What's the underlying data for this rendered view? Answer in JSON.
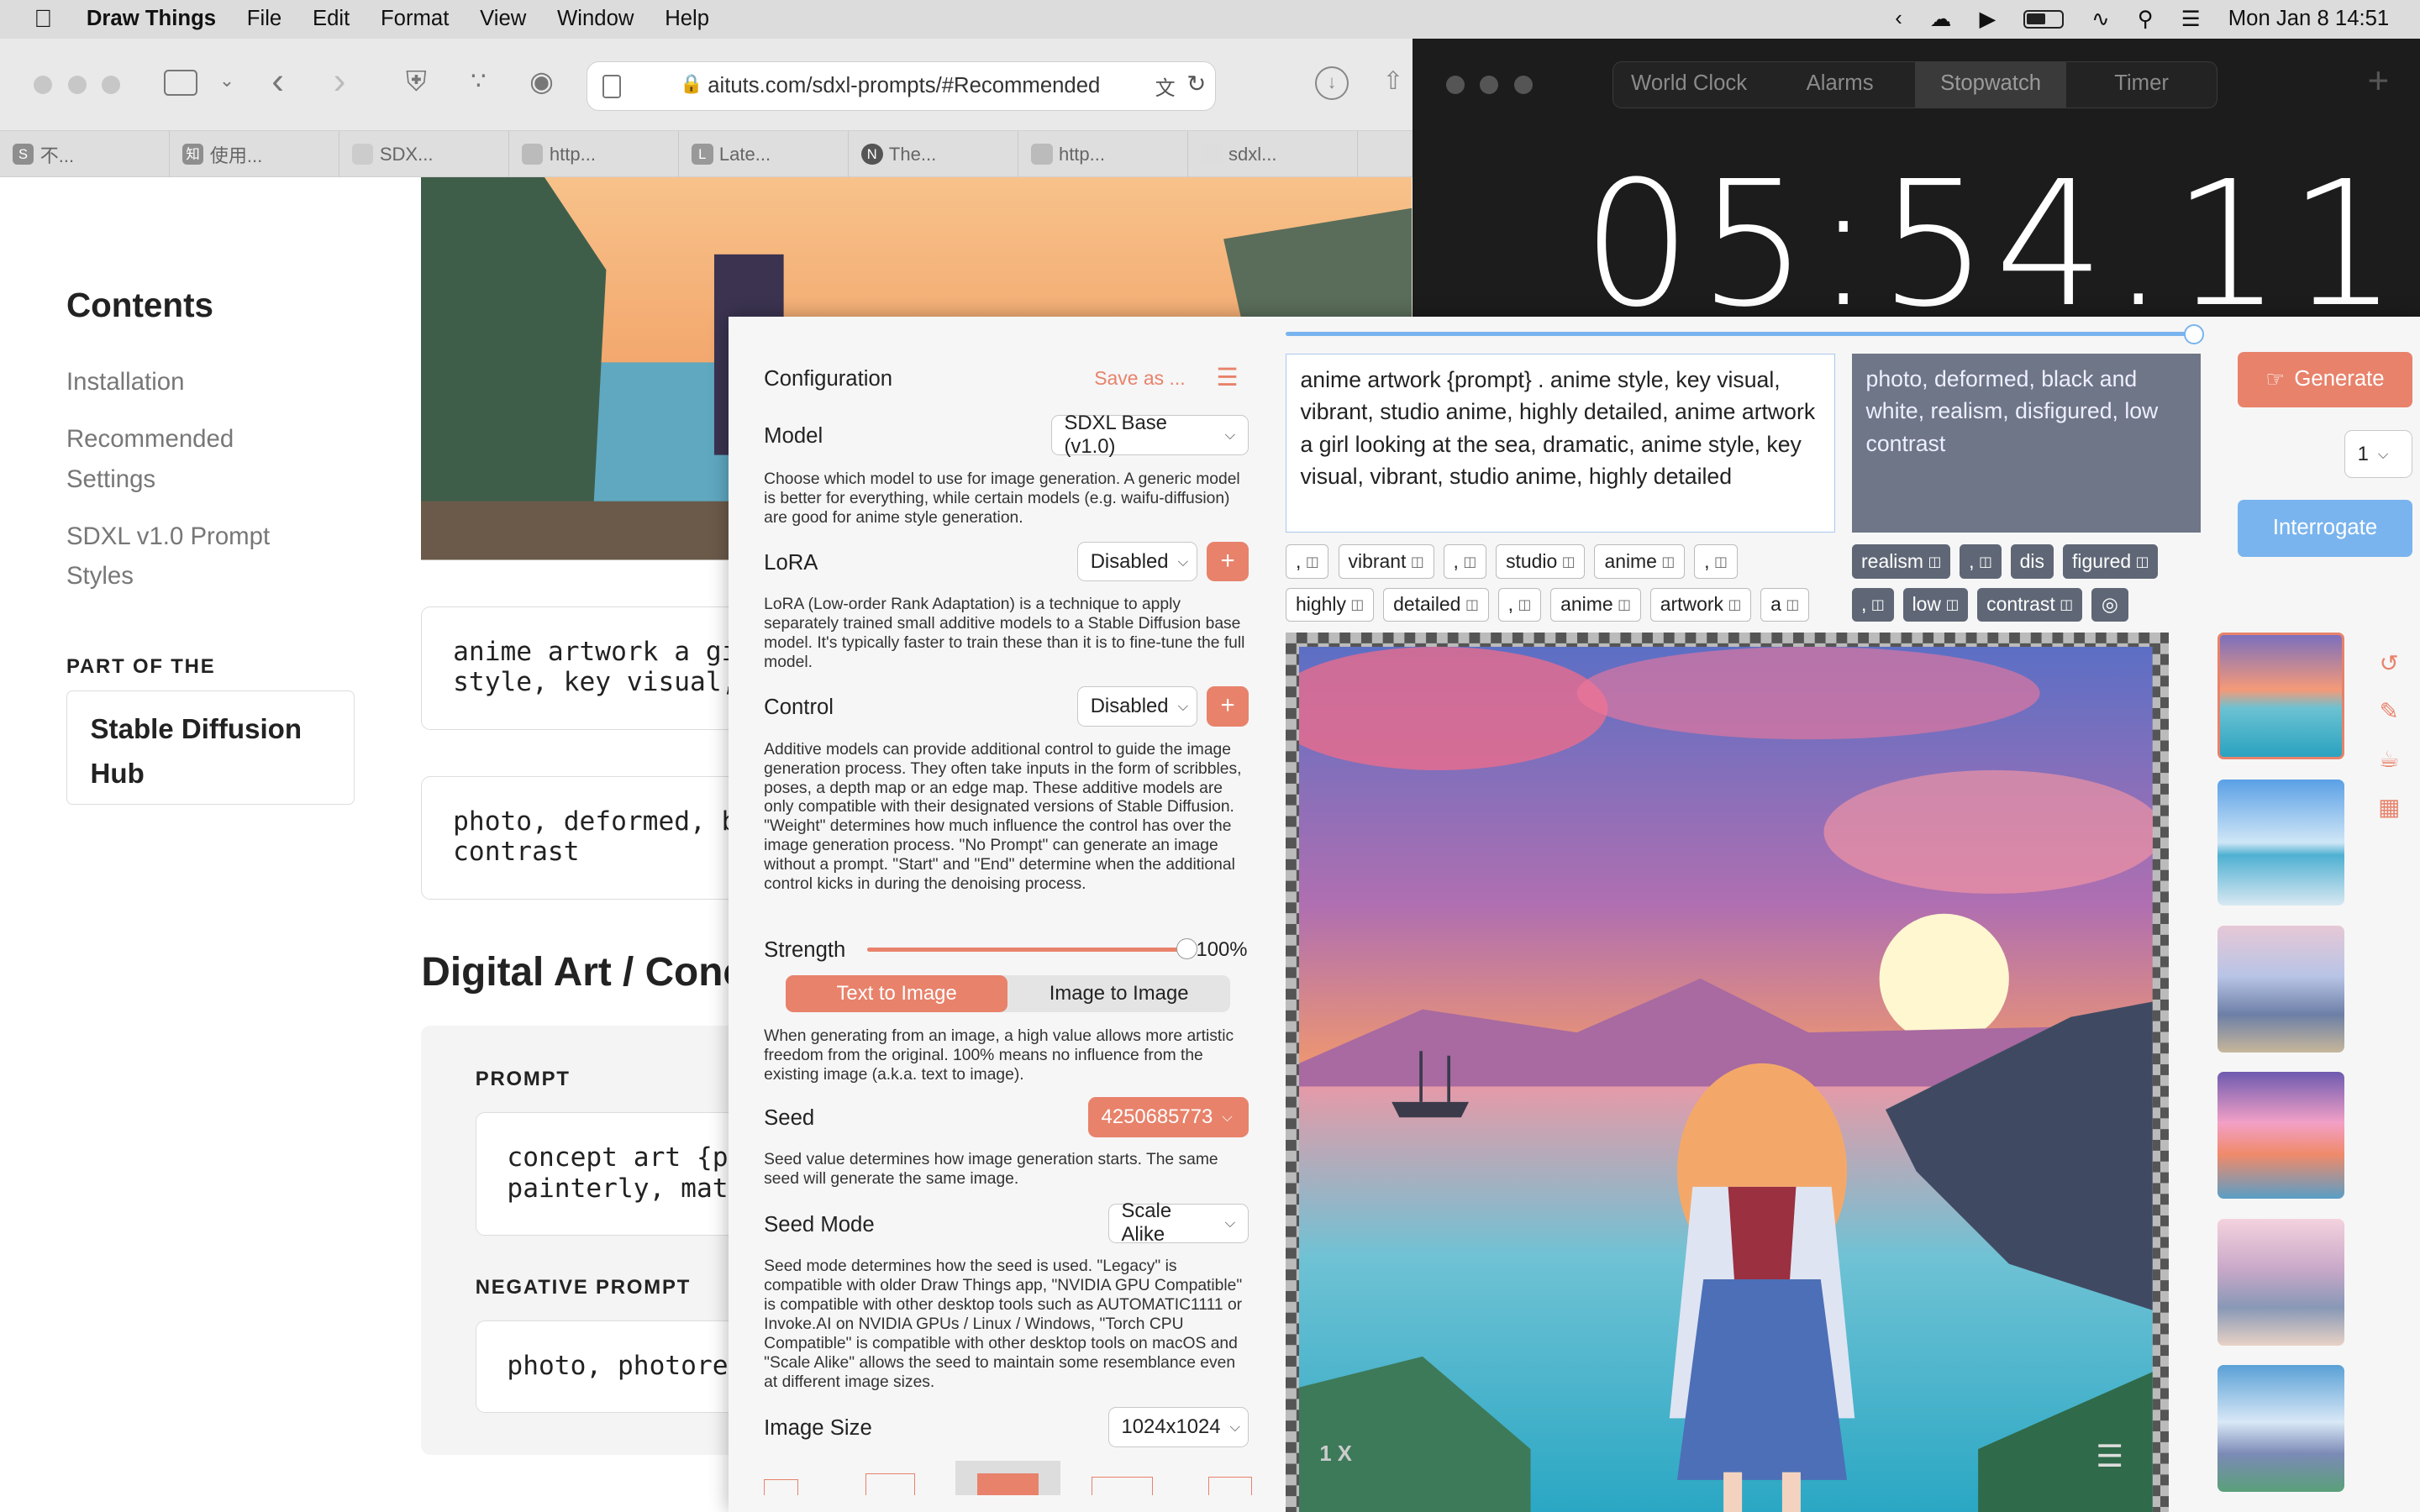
{
  "menubar": {
    "app": "Draw Things",
    "items": [
      "File",
      "Edit",
      "Format",
      "View",
      "Window",
      "Help"
    ],
    "datetime": "Mon Jan 8  14:51"
  },
  "browser": {
    "url": "aituts.com/sdxl-prompts/#Recommended",
    "tabs": [
      {
        "favicon": "S",
        "title": "不..."
      },
      {
        "favicon": "知",
        "title": "使用..."
      },
      {
        "favicon": "",
        "title": "SDX..."
      },
      {
        "favicon": "",
        "title": "http..."
      },
      {
        "favicon": "L",
        "title": "Late..."
      },
      {
        "favicon": "N",
        "title": "The..."
      },
      {
        "favicon": "",
        "title": "http..."
      },
      {
        "favicon": "",
        "title": "sdxl..."
      }
    ]
  },
  "page": {
    "contents_title": "Contents",
    "toc": [
      "Installation",
      "Recommended",
      "Settings",
      "SDXL v1.0 Prompt",
      "Styles"
    ],
    "part_of": "PART OF THE",
    "hub_line1": "Stable Diffusion",
    "hub_line2": "Hub",
    "code1_line1": "anime artwork a gi",
    "code1_line2": "style, key visual,",
    "code2_line1": "photo, deformed, b",
    "code2_line2": "contrast",
    "section_heading": "Digital Art / Conce",
    "prompt_label": "PROMPT",
    "code3_line1": "concept art {pr",
    "code3_line2": "painterly, matt",
    "neg_label": "NEGATIVE PROMPT",
    "code4_line1": "photo, photorea"
  },
  "clock": {
    "tabs": [
      "World Clock",
      "Alarms",
      "Stopwatch",
      "Timer"
    ],
    "selected_tab": "Stopwatch",
    "time": "05:54.11",
    "add": "+"
  },
  "drawthings": {
    "config_title": "Configuration",
    "save_as": "Save as ...",
    "model_label": "Model",
    "model_value": "SDXL Base (v1.0)",
    "model_desc": "Choose which model to use for image generation. A generic model is better for everything, while certain models (e.g. waifu-diffusion) are good for anime style generation.",
    "lora_label": "LoRA",
    "lora_value": "Disabled",
    "lora_desc": "LoRA (Low-order Rank Adaptation) is a technique to apply separately trained small additive models to a Stable Diffusion base model. It's typically faster to train these than it is to fine-tune the full model.",
    "control_label": "Control",
    "control_value": "Disabled",
    "control_desc": "Additive models can provide additional control to guide the image generation process. They often take inputs in the form of scribbles, poses, a depth map or an edge map. These additive models are only compatible with their designated versions of Stable Diffusion. \"Weight\" determines how much influence the control has over the image generation process. \"No Prompt\" can generate an image without a prompt. \"Start\" and \"End\" determine when the additional control kicks in during the denoising process.",
    "strength_label": "Strength",
    "strength_value": "100%",
    "strength_fraction": 1.0,
    "mode_txt2img": "Text to Image",
    "mode_img2img": "Image to Image",
    "strength_desc": "When generating from an image, a high value allows more artistic freedom from the original. 100% means no influence from the existing image (a.k.a. text to image).",
    "seed_label": "Seed",
    "seed_value": "4250685773",
    "seed_desc": "Seed value determines how image generation starts. The same seed will generate the same image.",
    "seed_mode_label": "Seed Mode",
    "seed_mode_value": "Scale Alike",
    "seed_mode_desc": "Seed mode determines how the seed is used. \"Legacy\" is compatible with older Draw Things app, \"NVIDIA GPU Compatible\" is compatible with other desktop tools such as AUTOMATIC1111 or Invoke.AI on NVIDIA GPUs / Linux / Windows, \"Torch CPU Compatible\" is compatible with other desktop tools on macOS and \"Scale Alike\" allows the seed to maintain some resemblance even at different image sizes.",
    "image_size_label": "Image Size",
    "image_size_value": "1024x1024",
    "prompt": "anime artwork {prompt} . anime style, key visual, vibrant, studio anime, highly detailed, anime artwork a girl looking at the sea, dramatic, anime style, key visual, vibrant, studio anime, highly detailed",
    "negative_prompt": "photo, deformed, black and white, realism, disfigured, low contrast",
    "tokens_row1": [
      ",",
      "vibrant",
      ",",
      "studio",
      "anime",
      ","
    ],
    "tokens_row2": [
      "highly",
      "detailed",
      ",",
      "anime",
      "artwork",
      "a"
    ],
    "neg_tokens_row1": [
      "realism",
      ",",
      "dis",
      "figured"
    ],
    "neg_tokens_row2": [
      ",",
      "low",
      "contrast"
    ],
    "generate": "Generate",
    "batch": "1",
    "interrogate": "Interrogate",
    "zoom": "1 X",
    "colors": {
      "accent": "#e8826b",
      "interrogate": "#79b4ee",
      "neg_bg": "#6e7687"
    }
  }
}
